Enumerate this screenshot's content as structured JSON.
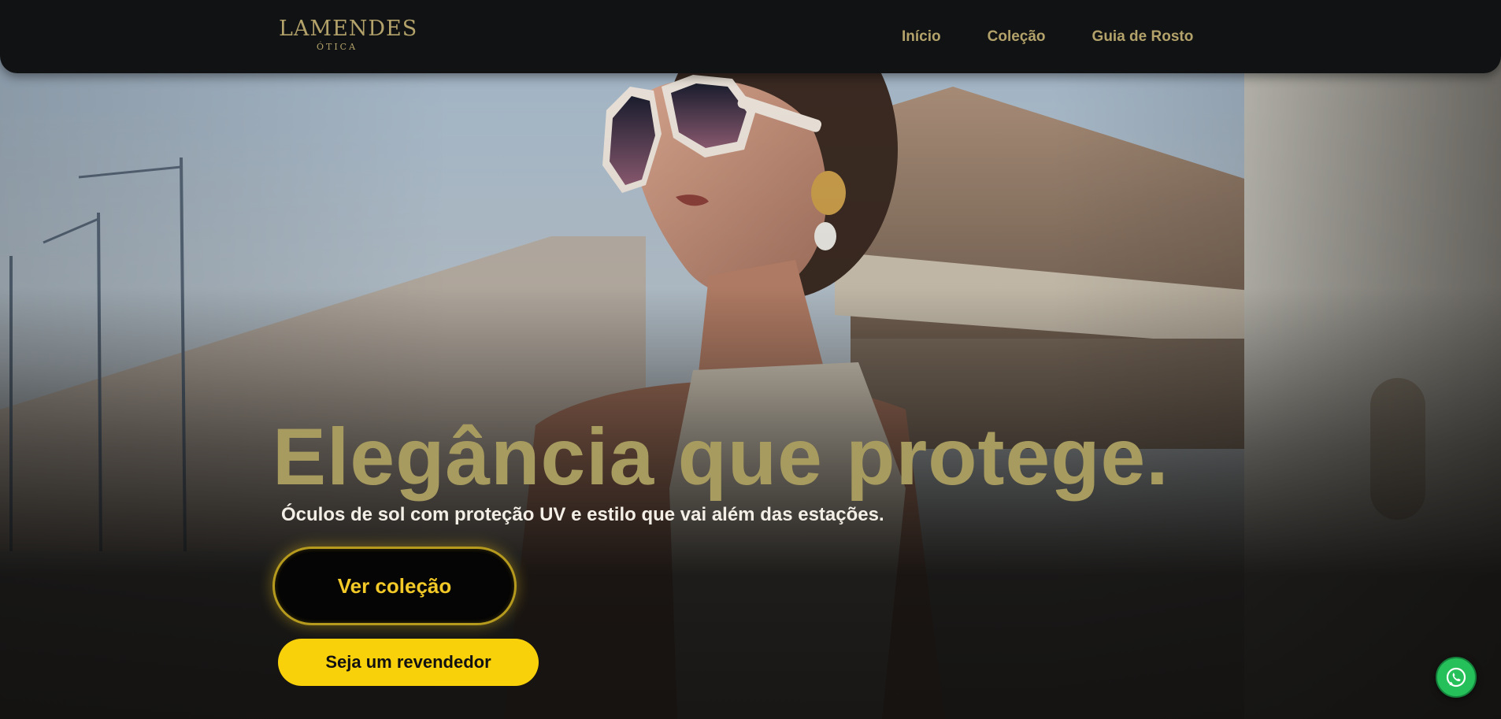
{
  "brand": {
    "name": "LAMENDES",
    "tagline": "ÓTICA",
    "color": "#b3a26a"
  },
  "nav": {
    "items": [
      {
        "label": "Início"
      },
      {
        "label": "Coleção"
      },
      {
        "label": "Guia de Rosto"
      }
    ]
  },
  "hero": {
    "headline": "Elegância que protege.",
    "subheadline": "Óculos de sol com proteção UV e estilo que vai além das estações.",
    "primary_button": "Ver coleção",
    "secondary_button": "Seja um revendedor",
    "headline_color": "#a79b5f",
    "accent_color": "#f9d10a"
  },
  "floating": {
    "whatsapp_icon": "whatsapp-icon",
    "color": "#25c05a"
  }
}
